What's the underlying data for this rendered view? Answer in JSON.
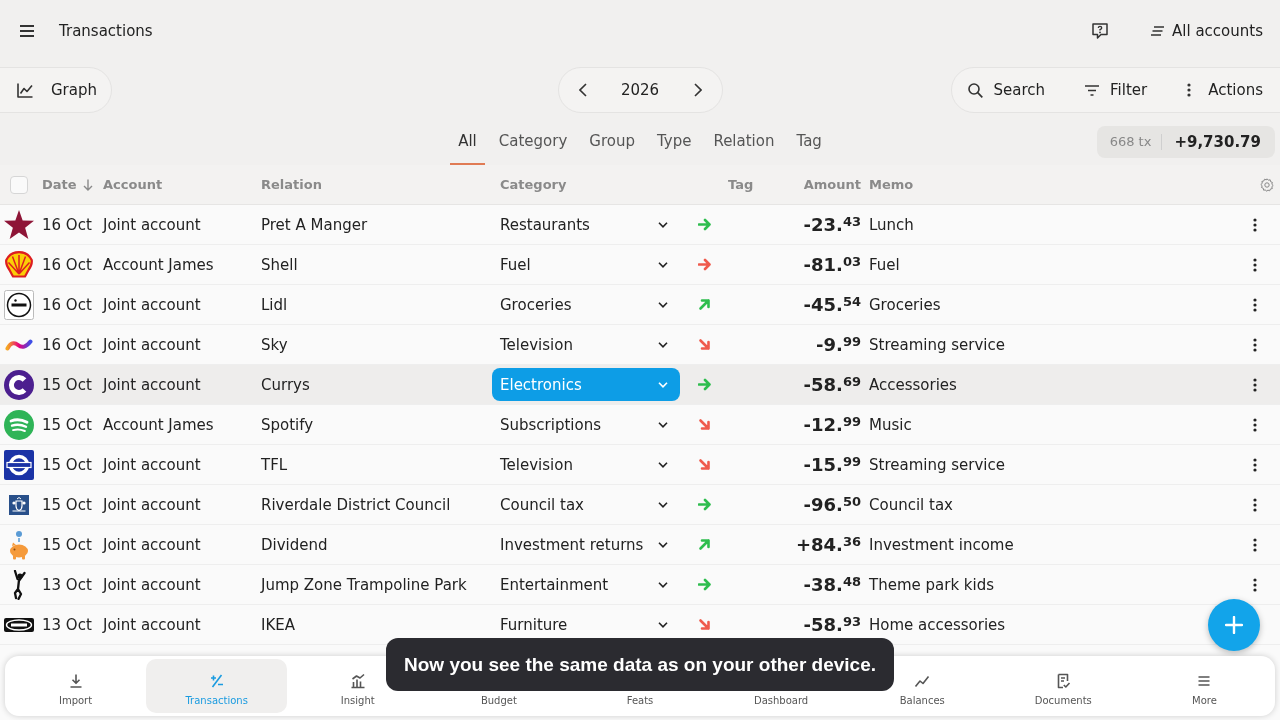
{
  "top_bar": {
    "title": "Transactions",
    "account_selector": "All accounts"
  },
  "toolbar": {
    "graph_button": "Graph",
    "year": "2026",
    "actions": [
      "Search",
      "Filter",
      "Actions"
    ]
  },
  "group_tabs": [
    {
      "label": "All",
      "selected": true
    },
    {
      "label": "Category",
      "selected": false
    },
    {
      "label": "Group",
      "selected": false
    },
    {
      "label": "Type",
      "selected": false
    },
    {
      "label": "Relation",
      "selected": false
    },
    {
      "label": "Tag",
      "selected": false
    }
  ],
  "summary": {
    "count": "668 tx",
    "total": "+9,730.79"
  },
  "table": {
    "select_all": {
      "checked": false
    },
    "columns": [
      {
        "label": "Date",
        "sorted": true
      },
      {
        "label": "Account",
        "sorted": false
      },
      {
        "label": "Relation",
        "sorted": false
      },
      {
        "label": "Category",
        "sorted": false
      },
      {
        "label": "Tag",
        "sorted": false
      },
      {
        "label": "Amount",
        "sorted": false
      },
      {
        "label": "Memo",
        "sorted": false
      }
    ],
    "rows": [
      {
        "date": "16 Oct",
        "account": "Joint account",
        "relation": "Pret A Manger",
        "category": "Restaurants",
        "arrow": {
          "kind": "right",
          "color": "#2ebd4e"
        },
        "amount": "-23.$^{43}$",
        "memo": "Lunch",
        "selected": false
      },
      {
        "date": "16 Oct",
        "account": "Account James",
        "relation": "Shell",
        "category": "Fuel",
        "arrow": {
          "kind": "right",
          "color": "#ef5a4c"
        },
        "amount": "-81.$^{03}$",
        "memo": "Fuel",
        "selected": false
      },
      {
        "date": "16 Oct",
        "account": "Joint account",
        "relation": "Lidl",
        "category": "Groceries",
        "arrow": {
          "kind": "rising",
          "color": "#2ebd4e"
        },
        "amount": "-45.$^{54}$",
        "memo": "Groceries",
        "selected": false
      },
      {
        "date": "16 Oct",
        "account": "Joint account",
        "relation": "Sky",
        "category": "Television",
        "arrow": {
          "kind": "falling",
          "color": "#ef5a4c"
        },
        "amount": "-9.$^{99}$",
        "memo": "Streaming service",
        "selected": false
      },
      {
        "date": "15 Oct",
        "account": "Joint account",
        "relation": "Currys",
        "category": "Electronics",
        "arrow": {
          "kind": "right",
          "color": "#2ebd4e"
        },
        "amount": "-58.$^{69}$",
        "memo": "Accessories",
        "selected": true
      },
      {
        "date": "15 Oct",
        "account": "Account James",
        "relation": "Spotify",
        "category": "Subscriptions",
        "arrow": {
          "kind": "falling",
          "color": "#ef5a4c"
        },
        "amount": "-12.$^{99}$",
        "memo": "Music",
        "selected": false
      },
      {
        "date": "15 Oct",
        "account": "Joint account",
        "relation": "TFL",
        "category": "Television",
        "arrow": {
          "kind": "falling",
          "color": "#ef5a4c"
        },
        "amount": "-15.$^{99}$",
        "memo": "Streaming service",
        "selected": false
      },
      {
        "date": "15 Oct",
        "account": "Joint account",
        "relation": "Riverdale District Council",
        "category": "Council tax",
        "arrow": {
          "kind": "right",
          "color": "#2ebd4e"
        },
        "amount": "-96.$^{50}$",
        "memo": "Council tax",
        "selected": false
      },
      {
        "date": "15 Oct",
        "account": "Joint account",
        "relation": "Dividend",
        "category": "Investment returns",
        "arrow": {
          "kind": "rising",
          "color": "#2ebd4e"
        },
        "amount": "+84.$^{36}$",
        "memo": "Investment income",
        "selected": false
      },
      {
        "date": "13 Oct",
        "account": "Joint account",
        "relation": "Jump Zone Trampoline Park",
        "category": "Entertainment",
        "arrow": {
          "kind": "right",
          "color": "#2ebd4e"
        },
        "amount": "-38.$^{48}$",
        "memo": "Theme park kids",
        "selected": false
      },
      {
        "date": "13 Oct",
        "account": "Joint account",
        "relation": "IKEA",
        "category": "Furniture",
        "arrow": {
          "kind": "falling",
          "color": "#ef5a4c"
        },
        "amount": "-58.$^{93}$",
        "memo": "Home accessories",
        "selected": false
      }
    ]
  },
  "toast": "Now you see the same data as on your other device.",
  "bottom_nav": [
    {
      "label": "Import",
      "selected": false
    },
    {
      "label": "Transactions",
      "selected": true
    },
    {
      "label": "Insight",
      "selected": false
    },
    {
      "label": "Budget",
      "selected": false
    },
    {
      "label": "Feats",
      "selected": false
    },
    {
      "label": "Dashboard",
      "selected": false
    },
    {
      "label": "Balances",
      "selected": false
    },
    {
      "label": "Documents",
      "selected": false
    },
    {
      "label": "More",
      "selected": false
    }
  ]
}
